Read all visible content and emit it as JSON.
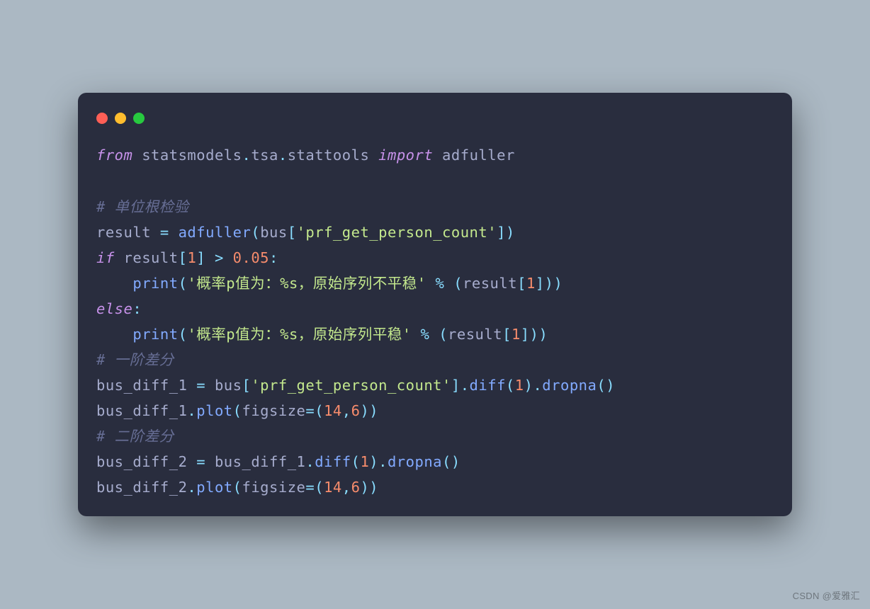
{
  "colors": {
    "page_bg": "#abb8c3",
    "window_bg": "#292d3e",
    "text": "#a6accd",
    "keyword": "#c792ea",
    "function": "#82aaff",
    "string": "#c3e88d",
    "number": "#f78c6c",
    "operator": "#89ddff",
    "comment": "#676e95",
    "dot_red": "#ff5f56",
    "dot_yellow": "#ffbd2e",
    "dot_green": "#27c93f"
  },
  "watermark": "CSDN @爱雅汇",
  "code": {
    "language": "python",
    "lines": [
      [
        {
          "t": "from",
          "c": "kw"
        },
        {
          "t": " ",
          "c": "id"
        },
        {
          "t": "statsmodels",
          "c": "mod"
        },
        {
          "t": ".",
          "c": "punc"
        },
        {
          "t": "tsa",
          "c": "mod"
        },
        {
          "t": ".",
          "c": "punc"
        },
        {
          "t": "stattools",
          "c": "mod"
        },
        {
          "t": " ",
          "c": "id"
        },
        {
          "t": "import",
          "c": "kw"
        },
        {
          "t": " ",
          "c": "id"
        },
        {
          "t": "adfuller",
          "c": "id"
        }
      ],
      [],
      [
        {
          "t": "# 单位根检验",
          "c": "cmt"
        }
      ],
      [
        {
          "t": "result",
          "c": "id"
        },
        {
          "t": " ",
          "c": "id"
        },
        {
          "t": "=",
          "c": "op"
        },
        {
          "t": " ",
          "c": "id"
        },
        {
          "t": "adfuller",
          "c": "fn"
        },
        {
          "t": "(",
          "c": "punc"
        },
        {
          "t": "bus",
          "c": "id"
        },
        {
          "t": "[",
          "c": "punc"
        },
        {
          "t": "'prf_get_person_count'",
          "c": "str"
        },
        {
          "t": "]",
          "c": "punc"
        },
        {
          "t": ")",
          "c": "punc"
        }
      ],
      [
        {
          "t": "if",
          "c": "kw"
        },
        {
          "t": " ",
          "c": "id"
        },
        {
          "t": "result",
          "c": "id"
        },
        {
          "t": "[",
          "c": "punc"
        },
        {
          "t": "1",
          "c": "num"
        },
        {
          "t": "]",
          "c": "punc"
        },
        {
          "t": " ",
          "c": "id"
        },
        {
          "t": ">",
          "c": "op"
        },
        {
          "t": " ",
          "c": "id"
        },
        {
          "t": "0.05",
          "c": "num"
        },
        {
          "t": ":",
          "c": "punc"
        }
      ],
      [
        {
          "t": "    ",
          "c": "id"
        },
        {
          "t": "print",
          "c": "fn"
        },
        {
          "t": "(",
          "c": "punc"
        },
        {
          "t": "'概率p值为：%s，原始序列不平稳'",
          "c": "str"
        },
        {
          "t": " ",
          "c": "id"
        },
        {
          "t": "%",
          "c": "op"
        },
        {
          "t": " ",
          "c": "id"
        },
        {
          "t": "(",
          "c": "punc"
        },
        {
          "t": "result",
          "c": "id"
        },
        {
          "t": "[",
          "c": "punc"
        },
        {
          "t": "1",
          "c": "num"
        },
        {
          "t": "]",
          "c": "punc"
        },
        {
          "t": ")",
          "c": "punc"
        },
        {
          "t": ")",
          "c": "punc"
        }
      ],
      [
        {
          "t": "else",
          "c": "kw"
        },
        {
          "t": ":",
          "c": "punc"
        }
      ],
      [
        {
          "t": "    ",
          "c": "id"
        },
        {
          "t": "print",
          "c": "fn"
        },
        {
          "t": "(",
          "c": "punc"
        },
        {
          "t": "'概率p值为：%s，原始序列平稳'",
          "c": "str"
        },
        {
          "t": " ",
          "c": "id"
        },
        {
          "t": "%",
          "c": "op"
        },
        {
          "t": " ",
          "c": "id"
        },
        {
          "t": "(",
          "c": "punc"
        },
        {
          "t": "result",
          "c": "id"
        },
        {
          "t": "[",
          "c": "punc"
        },
        {
          "t": "1",
          "c": "num"
        },
        {
          "t": "]",
          "c": "punc"
        },
        {
          "t": ")",
          "c": "punc"
        },
        {
          "t": ")",
          "c": "punc"
        }
      ],
      [
        {
          "t": "# 一阶差分",
          "c": "cmt"
        }
      ],
      [
        {
          "t": "bus_diff_1",
          "c": "id"
        },
        {
          "t": " ",
          "c": "id"
        },
        {
          "t": "=",
          "c": "op"
        },
        {
          "t": " ",
          "c": "id"
        },
        {
          "t": "bus",
          "c": "id"
        },
        {
          "t": "[",
          "c": "punc"
        },
        {
          "t": "'prf_get_person_count'",
          "c": "str"
        },
        {
          "t": "]",
          "c": "punc"
        },
        {
          "t": ".",
          "c": "punc"
        },
        {
          "t": "diff",
          "c": "fn"
        },
        {
          "t": "(",
          "c": "punc"
        },
        {
          "t": "1",
          "c": "num"
        },
        {
          "t": ")",
          "c": "punc"
        },
        {
          "t": ".",
          "c": "punc"
        },
        {
          "t": "dropna",
          "c": "fn"
        },
        {
          "t": "(",
          "c": "punc"
        },
        {
          "t": ")",
          "c": "punc"
        }
      ],
      [
        {
          "t": "bus_diff_1",
          "c": "id"
        },
        {
          "t": ".",
          "c": "punc"
        },
        {
          "t": "plot",
          "c": "fn"
        },
        {
          "t": "(",
          "c": "punc"
        },
        {
          "t": "figsize",
          "c": "id"
        },
        {
          "t": "=",
          "c": "op"
        },
        {
          "t": "(",
          "c": "punc"
        },
        {
          "t": "14",
          "c": "num"
        },
        {
          "t": ",",
          "c": "punc"
        },
        {
          "t": "6",
          "c": "num"
        },
        {
          "t": ")",
          "c": "punc"
        },
        {
          "t": ")",
          "c": "punc"
        }
      ],
      [
        {
          "t": "# 二阶差分",
          "c": "cmt"
        }
      ],
      [
        {
          "t": "bus_diff_2",
          "c": "id"
        },
        {
          "t": " ",
          "c": "id"
        },
        {
          "t": "=",
          "c": "op"
        },
        {
          "t": " ",
          "c": "id"
        },
        {
          "t": "bus_diff_1",
          "c": "id"
        },
        {
          "t": ".",
          "c": "punc"
        },
        {
          "t": "diff",
          "c": "fn"
        },
        {
          "t": "(",
          "c": "punc"
        },
        {
          "t": "1",
          "c": "num"
        },
        {
          "t": ")",
          "c": "punc"
        },
        {
          "t": ".",
          "c": "punc"
        },
        {
          "t": "dropna",
          "c": "fn"
        },
        {
          "t": "(",
          "c": "punc"
        },
        {
          "t": ")",
          "c": "punc"
        }
      ],
      [
        {
          "t": "bus_diff_2",
          "c": "id"
        },
        {
          "t": ".",
          "c": "punc"
        },
        {
          "t": "plot",
          "c": "fn"
        },
        {
          "t": "(",
          "c": "punc"
        },
        {
          "t": "figsize",
          "c": "id"
        },
        {
          "t": "=",
          "c": "op"
        },
        {
          "t": "(",
          "c": "punc"
        },
        {
          "t": "14",
          "c": "num"
        },
        {
          "t": ",",
          "c": "punc"
        },
        {
          "t": "6",
          "c": "num"
        },
        {
          "t": ")",
          "c": "punc"
        },
        {
          "t": ")",
          "c": "punc"
        }
      ]
    ]
  }
}
